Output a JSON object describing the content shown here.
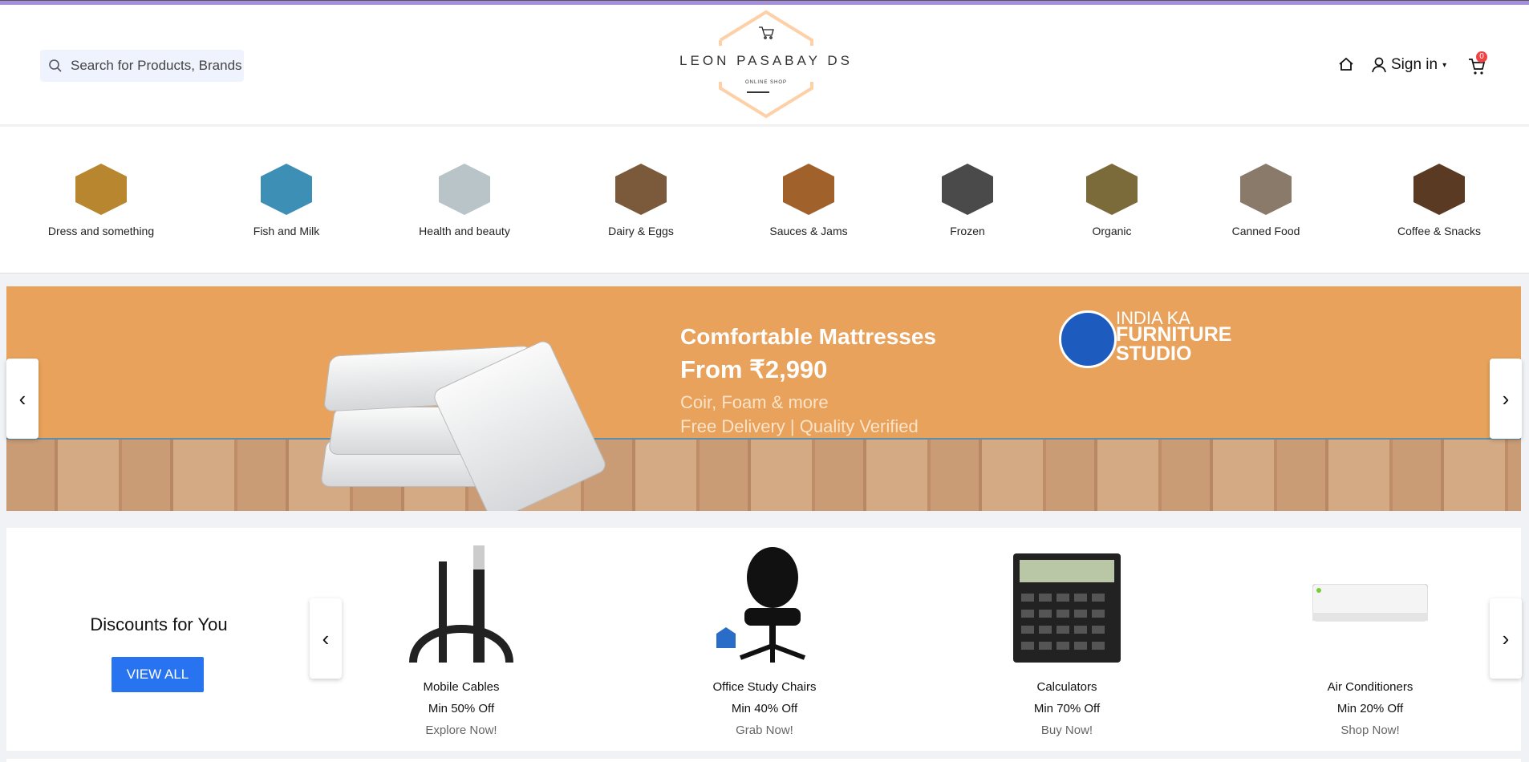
{
  "header": {
    "search_placeholder": "Search for Products, Brands",
    "logo_title": "LEON PASABAY DS",
    "logo_subtitle": "ONLINE SHOP",
    "signin_label": "Sign in",
    "cart_count": "0"
  },
  "categories": [
    {
      "label": "Dress and something",
      "color": "#b8862e"
    },
    {
      "label": "Fish and Milk",
      "color": "#3d8fb5"
    },
    {
      "label": "Health and beauty",
      "color": "#b9c4c8"
    },
    {
      "label": "Dairy & Eggs",
      "color": "#7a5a3a"
    },
    {
      "label": "Sauces & Jams",
      "color": "#a0612a"
    },
    {
      "label": "Frozen",
      "color": "#4a4a4a"
    },
    {
      "label": "Organic",
      "color": "#7b6a3a"
    },
    {
      "label": "Canned Food",
      "color": "#8a7a6a"
    },
    {
      "label": "Coffee & Snacks",
      "color": "#5a3a22"
    }
  ],
  "banner": {
    "headline": "Comfortable Mattresses",
    "price": "From ₹2,990",
    "line1": "Coir, Foam & more",
    "line2": "Free Delivery | Quality Verified",
    "brand_top": "INDIA KA",
    "brand_main": "FURNITURE STUDIO"
  },
  "discounts": {
    "title": "Discounts for You",
    "view_all": "VIEW ALL",
    "products": [
      {
        "name": "Mobile Cables",
        "offer": "Min 50% Off",
        "cta": "Explore Now!"
      },
      {
        "name": "Office Study Chairs",
        "offer": "Min 40% Off",
        "cta": "Grab Now!"
      },
      {
        "name": "Calculators",
        "offer": "Min 70% Off",
        "cta": "Buy Now!"
      },
      {
        "name": "Air Conditioners",
        "offer": "Min 20% Off",
        "cta": "Shop Now!"
      }
    ]
  }
}
